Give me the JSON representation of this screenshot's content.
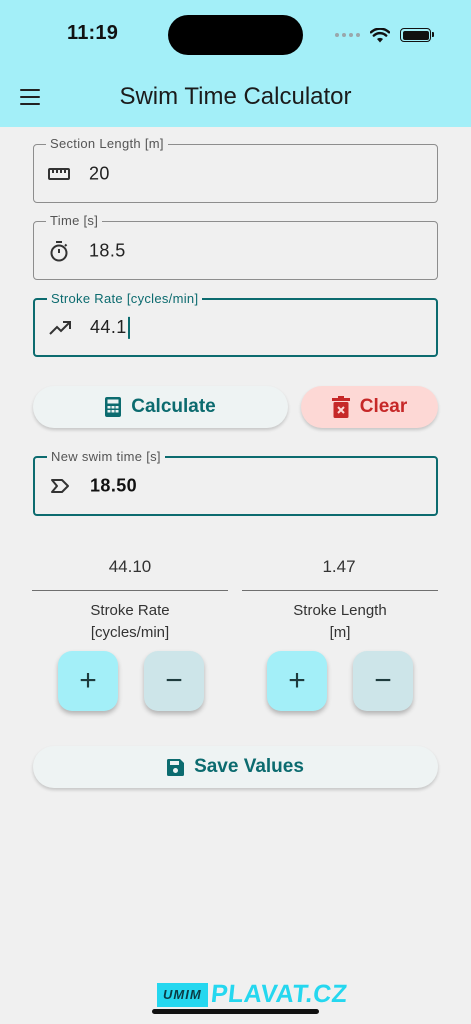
{
  "status_bar": {
    "time": "11:19"
  },
  "app_bar": {
    "title": "Swim Time Calculator",
    "menu_icon": "hamburger-menu-icon"
  },
  "colors": {
    "header": "#a3eff8",
    "accent": "#0c6b6f",
    "clear": "#c62828",
    "logo": "#25d7ef"
  },
  "fields": {
    "section_length": {
      "label": "Section Length [m]",
      "value": "20",
      "icon": "ruler-icon"
    },
    "time": {
      "label": "Time [s]",
      "value": "18.5",
      "icon": "timer-icon"
    },
    "stroke_rate": {
      "label": "Stroke Rate [cycles/min]",
      "value": "44.1",
      "icon": "trending-up-icon"
    },
    "new_swim_time": {
      "label": "New swim time [s]",
      "value": "18.50",
      "icon": "label-arrow-icon"
    }
  },
  "buttons": {
    "calculate": "Calculate",
    "clear": "Clear",
    "save": "Save Values"
  },
  "stats": {
    "stroke_rate": {
      "value": "44.10",
      "label_line1": "Stroke Rate",
      "label_line2": "[cycles/min]"
    },
    "stroke_length": {
      "value": "1.47",
      "label_line1": "Stroke Length",
      "label_line2": "[m]"
    }
  },
  "steppers": {
    "plus": "+",
    "minus": "−"
  },
  "footer": {
    "logo_part1": "UMIM",
    "logo_part2": "PLAVAT.CZ"
  }
}
